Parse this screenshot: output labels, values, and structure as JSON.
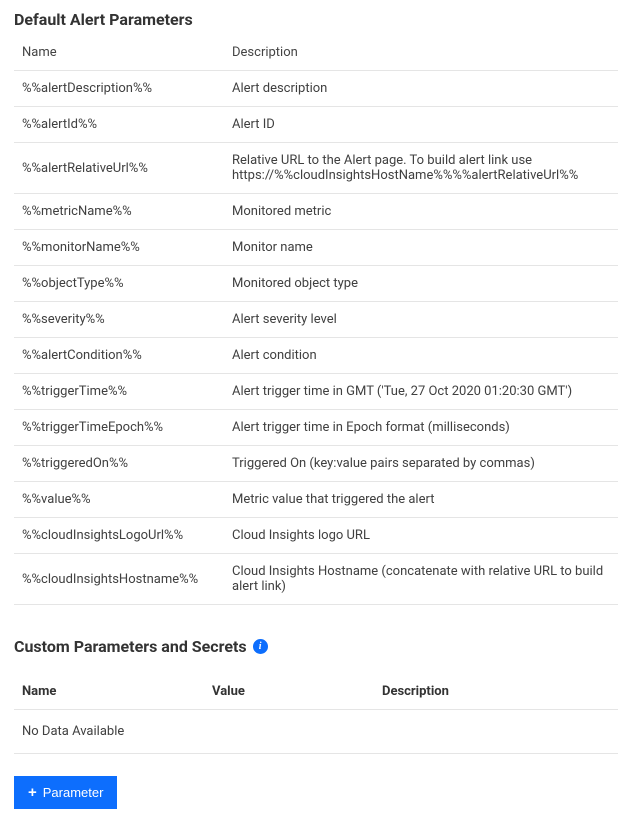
{
  "defaultAlertParams": {
    "title": "Default Alert Parameters",
    "headers": {
      "name": "Name",
      "description": "Description"
    },
    "rows": [
      {
        "name": "%%alertDescription%%",
        "description": "Alert description"
      },
      {
        "name": "%%alertId%%",
        "description": "Alert ID"
      },
      {
        "name": "%%alertRelativeUrl%%",
        "description": "Relative URL to the Alert page. To build alert link use https://%%cloudInsightsHostName%%%%alertRelativeUrl%%"
      },
      {
        "name": "%%metricName%%",
        "description": "Monitored metric"
      },
      {
        "name": "%%monitorName%%",
        "description": "Monitor name"
      },
      {
        "name": "%%objectType%%",
        "description": "Monitored object type"
      },
      {
        "name": "%%severity%%",
        "description": "Alert severity level"
      },
      {
        "name": "%%alertCondition%%",
        "description": "Alert condition"
      },
      {
        "name": "%%triggerTime%%",
        "description": "Alert trigger time in GMT ('Tue, 27 Oct 2020 01:20:30 GMT')"
      },
      {
        "name": "%%triggerTimeEpoch%%",
        "description": "Alert trigger time in Epoch format (milliseconds)"
      },
      {
        "name": "%%triggeredOn%%",
        "description": "Triggered On (key:value pairs separated by commas)"
      },
      {
        "name": "%%value%%",
        "description": "Metric value that triggered the alert"
      },
      {
        "name": "%%cloudInsightsLogoUrl%%",
        "description": "Cloud Insights logo URL"
      },
      {
        "name": "%%cloudInsightsHostname%%",
        "description": "Cloud Insights Hostname (concatenate with relative URL to build alert link)"
      }
    ]
  },
  "customParams": {
    "title": "Custom Parameters and Secrets",
    "headers": {
      "name": "Name",
      "value": "Value",
      "description": "Description"
    },
    "emptyText": "No Data Available",
    "addButton": "Parameter"
  }
}
